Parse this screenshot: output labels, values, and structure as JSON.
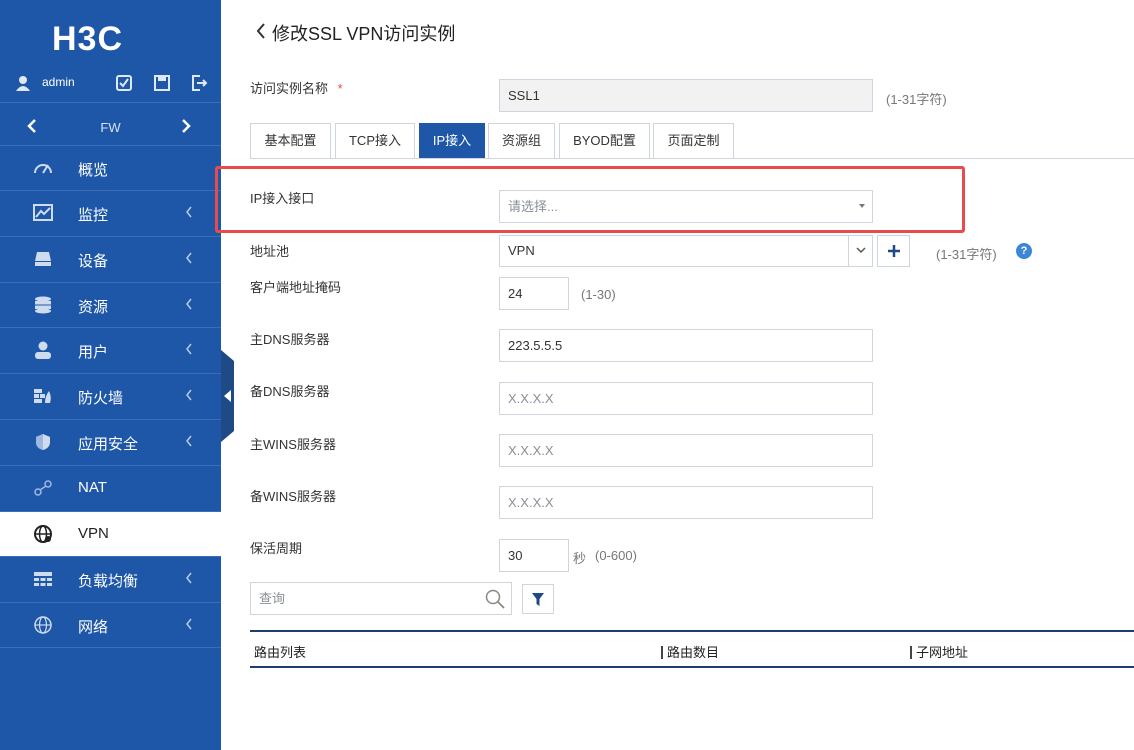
{
  "sidebar": {
    "logo": "H3C",
    "user": "admin",
    "device": "FW",
    "items": [
      {
        "label": "概览",
        "icon": "dashboard-icon",
        "chevron": false
      },
      {
        "label": "监控",
        "icon": "monitor-icon",
        "chevron": true
      },
      {
        "label": "设备",
        "icon": "device-icon",
        "chevron": true
      },
      {
        "label": "资源",
        "icon": "database-icon",
        "chevron": true
      },
      {
        "label": "用户",
        "icon": "user-icon",
        "chevron": true
      },
      {
        "label": "防火墙",
        "icon": "firewall-icon",
        "chevron": true
      },
      {
        "label": "应用安全",
        "icon": "shield-icon",
        "chevron": true
      },
      {
        "label": "NAT",
        "icon": "nat-icon",
        "chevron": false
      },
      {
        "label": "VPN",
        "icon": "globe-icon",
        "chevron": false,
        "active": true
      },
      {
        "label": "负载均衡",
        "icon": "load-balance-icon",
        "chevron": true
      },
      {
        "label": "网络",
        "icon": "network-icon",
        "chevron": true
      }
    ]
  },
  "page": {
    "title": "修改SSL VPN访问实例",
    "instance_name_label": "访问实例名称",
    "required_mark": "*",
    "instance_name_value": "SSL1",
    "instance_name_hint": "(1-31字符)",
    "tabs": [
      "基本配置",
      "TCP接入",
      "IP接入",
      "资源组",
      "BYOD配置",
      "页面定制"
    ],
    "active_tab": "IP接入"
  },
  "form": {
    "ip_interface_label": "IP接入接口",
    "ip_interface_placeholder": "请选择...",
    "pool_label": "地址池",
    "pool_value": "VPN",
    "pool_hint": "(1-31字符)",
    "mask_label": "客户端地址掩码",
    "mask_value": "24",
    "mask_hint": "(1-30)",
    "dns1_label": "主DNS服务器",
    "dns1_value": "223.5.5.5",
    "dns2_label": "备DNS服务器",
    "dns2_placeholder": "X.X.X.X",
    "wins1_label": "主WINS服务器",
    "wins1_placeholder": "X.X.X.X",
    "wins2_label": "备WINS服务器",
    "wins2_placeholder": "X.X.X.X",
    "keepalive_label": "保活周期",
    "keepalive_value": "30",
    "keepalive_unit": "秒",
    "keepalive_hint": "(0-600)",
    "help_mark": "?"
  },
  "routes": {
    "search_placeholder": "查询",
    "columns": [
      "路由列表",
      "路由数目",
      "子网地址"
    ]
  },
  "colors": {
    "sidebar": "#1e57a7",
    "highlight": "#e84b4b",
    "help": "#3b86d6"
  }
}
